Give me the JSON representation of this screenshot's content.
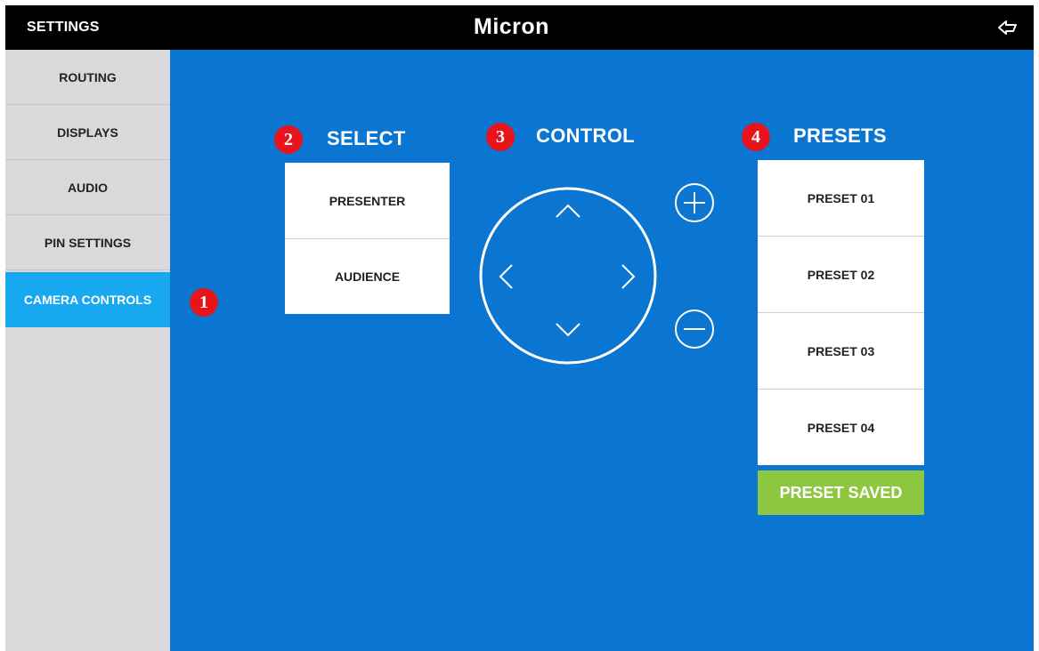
{
  "header": {
    "title": "SETTINGS",
    "logo_text": "Micron",
    "back_icon": "back-arrow-icon"
  },
  "sidebar": {
    "items": [
      {
        "label": "ROUTING"
      },
      {
        "label": "DISPLAYS"
      },
      {
        "label": "AUDIO"
      },
      {
        "label": "PIN SETTINGS"
      },
      {
        "label": "CAMERA CONTROLS",
        "active": true
      }
    ]
  },
  "badges": [
    "1",
    "2",
    "3",
    "4"
  ],
  "select": {
    "title": "SELECT",
    "options": [
      "PRESENTER",
      "AUDIENCE"
    ]
  },
  "control": {
    "title": "CONTROL",
    "icons": [
      "up-arrow-icon",
      "down-arrow-icon",
      "left-arrow-icon",
      "right-arrow-icon",
      "zoom-in-icon",
      "zoom-out-icon"
    ]
  },
  "presets": {
    "title": "PRESETS",
    "items": [
      "PRESET 01",
      "PRESET 02",
      "PRESET 03",
      "PRESET 04"
    ],
    "status": "PRESET SAVED"
  },
  "colors": {
    "main_bg": "#0a76d1",
    "active_sidebar": "#18a8f0",
    "sidebar_bg": "#d9d9d9",
    "badge": "#e8141b",
    "saved": "#8dc63f"
  }
}
